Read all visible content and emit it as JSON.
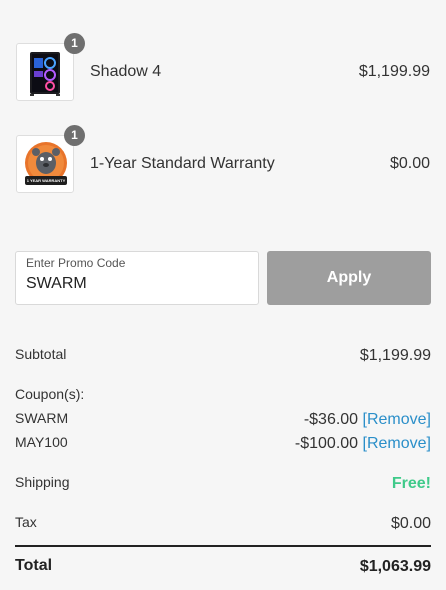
{
  "cart": {
    "items": [
      {
        "name": "Shadow 4",
        "price": "$1,199.99",
        "quantity": "1",
        "image": "gaming-pc-case"
      },
      {
        "name": "1-Year Standard Warranty",
        "price": "$0.00",
        "quantity": "1",
        "image": "warranty-badge",
        "badge_text": "1 YEAR WARRANTY"
      }
    ]
  },
  "promo": {
    "label": "Enter Promo Code",
    "value": "SWARM",
    "apply_label": "Apply"
  },
  "summary": {
    "subtotal_label": "Subtotal",
    "subtotal_value": "$1,199.99",
    "coupons_label": "Coupon(s):",
    "coupons": [
      {
        "code": "SWARM",
        "amount": "-$36.00",
        "remove_label": "[Remove]"
      },
      {
        "code": "MAY100",
        "amount": "-$100.00",
        "remove_label": "[Remove]"
      }
    ],
    "shipping_label": "Shipping",
    "shipping_value": "Free!",
    "tax_label": "Tax",
    "tax_value": "$0.00",
    "total_label": "Total",
    "total_value": "$1,063.99"
  },
  "colors": {
    "background": "#f6f6f6",
    "apply_button": "#9e9e9e",
    "link": "#2b8fc9",
    "free_shipping": "#3fca8a",
    "qty_badge": "#6f6f6f"
  }
}
